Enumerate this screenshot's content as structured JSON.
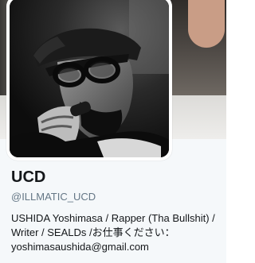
{
  "profile": {
    "display_name": "UCD",
    "handle": "@ILLMATIC_UCD",
    "bio": "USHIDA Yoshimasa / Rapper (Tha Bullshit) / Writer / SEALDs /お仕事ください：yoshimasaushida@gmail.com"
  },
  "colors": {
    "name_text": "#14171a",
    "handle_text": "#657786",
    "panel_background": "#f5f8fa"
  }
}
